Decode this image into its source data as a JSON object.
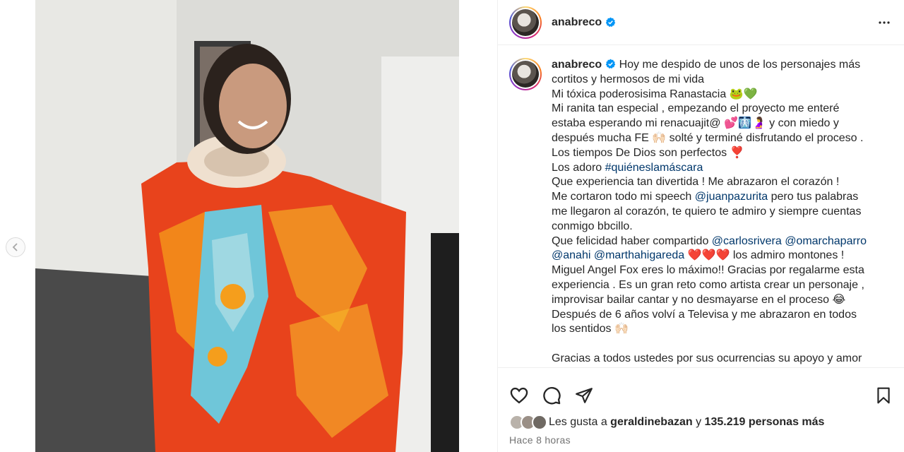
{
  "post": {
    "username": "anabreco",
    "caption_lines": [
      {
        "segments": [
          {
            "t": "Hoy me despido de unos de los personajes más"
          }
        ]
      },
      {
        "segments": [
          {
            "t": "cortitos y hermosos de mi vida"
          }
        ]
      },
      {
        "segments": [
          {
            "t": "Mi tóxica poderosisima Ranastacia 🐸💚"
          }
        ]
      },
      {
        "segments": [
          {
            "t": "Mi ranita tan especial , empezando el proyecto me enteré"
          }
        ]
      },
      {
        "segments": [
          {
            "t": "estaba esperando mi renacuajit@ 💕🩻🤰 y con miedo y"
          }
        ]
      },
      {
        "segments": [
          {
            "t": "después mucha FE 🙌🏻 solté y terminé disfrutando el proceso ."
          }
        ]
      },
      {
        "segments": [
          {
            "t": "Los tiempos De Dios son perfectos ❣️"
          }
        ]
      },
      {
        "segments": [
          {
            "t": "Los adoro "
          },
          {
            "t": "#quiéneslamáscara",
            "m": true
          }
        ]
      },
      {
        "segments": [
          {
            "t": "Que experiencia tan divertida ! Me abrazaron el corazón !"
          }
        ]
      },
      {
        "segments": [
          {
            "t": "Me cortaron todo mi speech "
          },
          {
            "t": "@juanpazurita",
            "m": true
          },
          {
            "t": " pero tus palabras"
          }
        ]
      },
      {
        "segments": [
          {
            "t": "me llegaron al corazón, te quiero te admiro y siempre cuentas"
          }
        ]
      },
      {
        "segments": [
          {
            "t": "conmigo bbcillo."
          }
        ]
      },
      {
        "segments": [
          {
            "t": "Que felicidad haber compartido "
          },
          {
            "t": "@carlosrivera",
            "m": true
          },
          {
            "t": " "
          },
          {
            "t": "@omarchaparro",
            "m": true
          }
        ]
      },
      {
        "segments": [
          {
            "t": "@anahi",
            "m": true
          },
          {
            "t": " "
          },
          {
            "t": "@marthahigareda",
            "m": true
          },
          {
            "t": " ❤️❤️❤️ los admiro montones !"
          }
        ]
      },
      {
        "segments": [
          {
            "t": "Miguel Angel Fox eres lo máximo!! Gracias por regalarme esta"
          }
        ]
      },
      {
        "segments": [
          {
            "t": "experiencia . Es un gran reto como artista crear un personaje ,"
          }
        ]
      },
      {
        "segments": [
          {
            "t": "improvisar bailar cantar y no desmayarse en el proceso 😂"
          }
        ]
      },
      {
        "segments": [
          {
            "t": "Después de 6 años volví a Televisa y me abrazaron en todos"
          }
        ]
      },
      {
        "segments": [
          {
            "t": "los sentidos 🙌🏻"
          }
        ]
      },
      {
        "segments": []
      },
      {
        "segments": [
          {
            "t": "Gracias a todos ustedes por sus ocurrencias su apoyo y amor"
          }
        ]
      }
    ],
    "likes_prefix": "Les gusta a ",
    "likes_user": "geraldinebazan",
    "likes_middle": " y ",
    "likes_count": "135.219 personas más",
    "timestamp": "Hace 8 horas"
  },
  "icons": {
    "verified": "verified-badge-icon",
    "more": "more-options-icon",
    "like": "heart-icon",
    "comment": "comment-icon",
    "share": "share-icon",
    "save": "bookmark-icon",
    "prev": "chevron-left-icon"
  },
  "colors": {
    "verified": "#0095f6",
    "mention": "#00376b",
    "text": "#262626",
    "muted": "#737373"
  }
}
